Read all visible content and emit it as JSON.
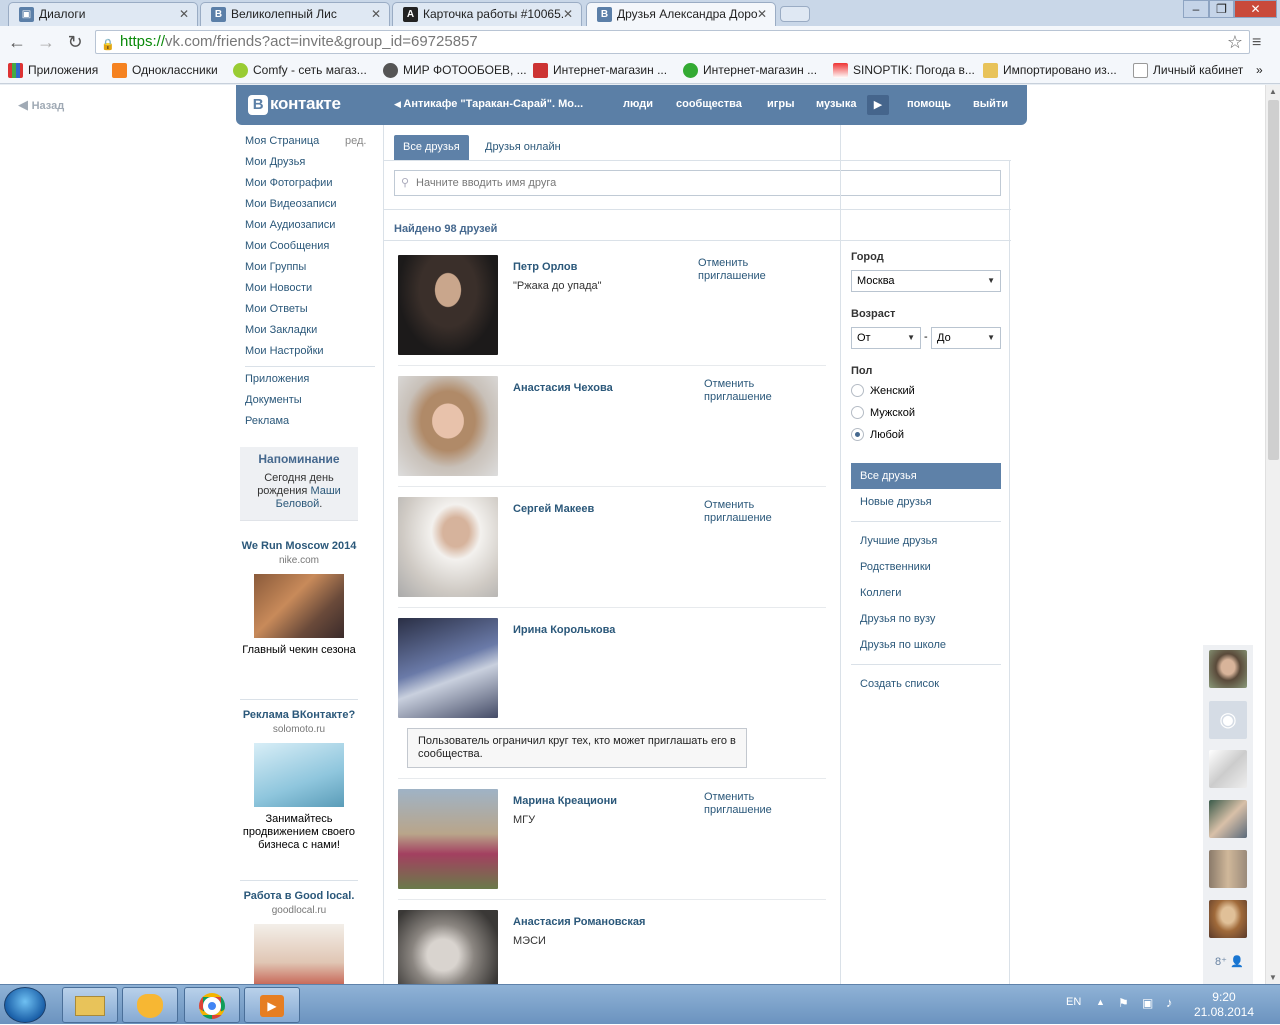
{
  "browser": {
    "tabs": [
      {
        "title": "Диалоги",
        "icon": "В"
      },
      {
        "title": "Великолепный Лис",
        "icon": "В"
      },
      {
        "title": "Карточка работы #10065.",
        "icon": "A"
      },
      {
        "title": "Друзья Александра Доро",
        "icon": "В"
      }
    ],
    "url_proto": "https://",
    "url_rest": "vk.com/friends?act=invite&group_id=69725857",
    "bookmarks": [
      "Приложения",
      "Одноклассники",
      "Comfy - сеть магаз...",
      "МИР ФОТООБОЕВ, ...",
      "Интернет-магазин ...",
      "Интернет-магазин ...",
      "SINOPTIK: Погода в...",
      "Импортировано из...",
      "Личный кабинет"
    ]
  },
  "vk": {
    "back": "Назад",
    "logo_b": "В",
    "logo_text": "контакте",
    "group_link": "Антикафе \"Таракан-Сарай\". Мо...",
    "nav": [
      "люди",
      "сообщества",
      "игры",
      "музыка",
      "помощь",
      "выйти"
    ],
    "left_menu": [
      "Моя Страница",
      "Мои Друзья",
      "Мои Фотографии",
      "Мои Видеозаписи",
      "Мои Аудиозаписи",
      "Мои Сообщения",
      "Мои Группы",
      "Мои Новости",
      "Мои Ответы",
      "Мои Закладки",
      "Мои Настройки"
    ],
    "edit": "ред.",
    "left_menu2": [
      "Приложения",
      "Документы",
      "Реклама"
    ],
    "reminder": {
      "title": "Напоминание",
      "today": "Сегодня ",
      "birthday": "день рождения ",
      "name": "Маши Беловой",
      "dot": "."
    },
    "ads": [
      {
        "title": "We Run Moscow 2014",
        "domain": "nike.com",
        "text": "Главный чекин сезона"
      },
      {
        "title": "Реклама ВКонтакте?",
        "domain": "solomoto.ru",
        "text": "Занимайтесь продвижением своего бизнеса с нами!"
      },
      {
        "title": "Работа в Good local.",
        "domain": "goodlocal.ru",
        "text": ""
      }
    ],
    "tabs": [
      "Все друзья",
      "Друзья онлайн"
    ],
    "search_placeholder": "Начните вводить имя друга",
    "found": "Найдено 98 друзей",
    "friends": [
      {
        "name": "Петр Орлов",
        "sub": "\"Ржака до упада\"",
        "action": "Отменить приглашение"
      },
      {
        "name": "Анастасия Чехова",
        "sub": "",
        "action": "Отменить приглашение"
      },
      {
        "name": "Сергей Макеев",
        "sub": "",
        "action": "Отменить приглашение"
      },
      {
        "name": "Ирина Королькова",
        "sub": "",
        "action": "",
        "note": "Пользователь ограничил круг тех, кто может приглашать его в сообщества."
      },
      {
        "name": "Марина Креациони",
        "sub": "МГУ",
        "action": "Отменить приглашение"
      },
      {
        "name": "Анастасия Романовская",
        "sub": "МЭСИ",
        "action": ""
      }
    ],
    "filters": {
      "city_label": "Город",
      "city_value": "Москва",
      "age_label": "Возраст",
      "age_from": "От",
      "age_dash": "-",
      "age_to": "До",
      "sex_label": "Пол",
      "sex_options": [
        "Женский",
        "Мужской",
        "Любой"
      ],
      "sex_selected": 2,
      "lists": [
        "Все друзья",
        "Новые друзья"
      ],
      "lists2": [
        "Лучшие друзья",
        "Родственники",
        "Коллеги",
        "Друзья по вузу",
        "Друзья по школе"
      ],
      "create": "Создать список"
    }
  },
  "taskbar": {
    "lang": "EN",
    "time": "9:20",
    "date": "21.08.2014"
  }
}
